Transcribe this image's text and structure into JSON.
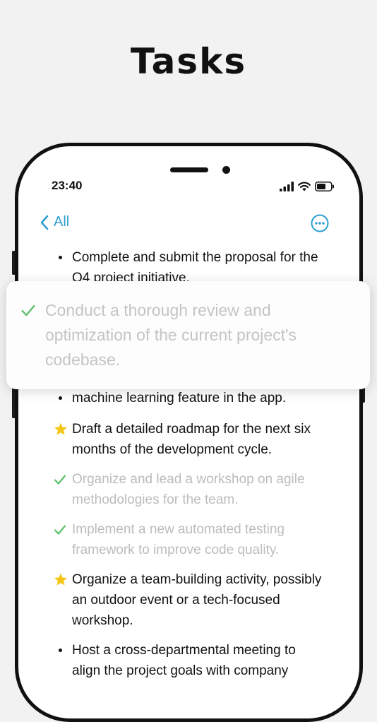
{
  "header": {
    "title": "Tasks"
  },
  "status_bar": {
    "time": "23:40",
    "icons": [
      "cellular-signal-icon",
      "wifi-icon",
      "battery-icon"
    ]
  },
  "nav": {
    "back_label": "All",
    "more_icon": "ellipsis-circle-icon"
  },
  "colors": {
    "accent": "#2f9fd0",
    "check": "#5cbf6a",
    "star": "#f5c518",
    "done_text": "#bcbcbc",
    "text": "#111111"
  },
  "tasks": [
    {
      "text": "Complete and submit the proposal for the Q4 project initiative.",
      "status": "open",
      "marker": "bullet"
    },
    {
      "text": "machine learning feature in the app.",
      "status": "open",
      "marker": "bullet"
    },
    {
      "text": "Draft a detailed roadmap for the next six months of the development cycle.",
      "status": "important",
      "marker": "star"
    },
    {
      "text": "Organize and lead a workshop on agile methodologies for the team.",
      "status": "done",
      "marker": "check"
    },
    {
      "text": "Implement a new automated testing framework to improve code quality.",
      "status": "done",
      "marker": "check"
    },
    {
      "text": "Organize a team-building activity, possibly an outdoor event or a tech-focused workshop.",
      "status": "important",
      "marker": "star"
    },
    {
      "text": "Host a cross-departmental meeting to align the project goals with company",
      "status": "open",
      "marker": "bullet"
    }
  ],
  "dragged_task": {
    "text": "Conduct a thorough review and optimization of the current project's codebase.",
    "status": "done",
    "marker": "check"
  }
}
